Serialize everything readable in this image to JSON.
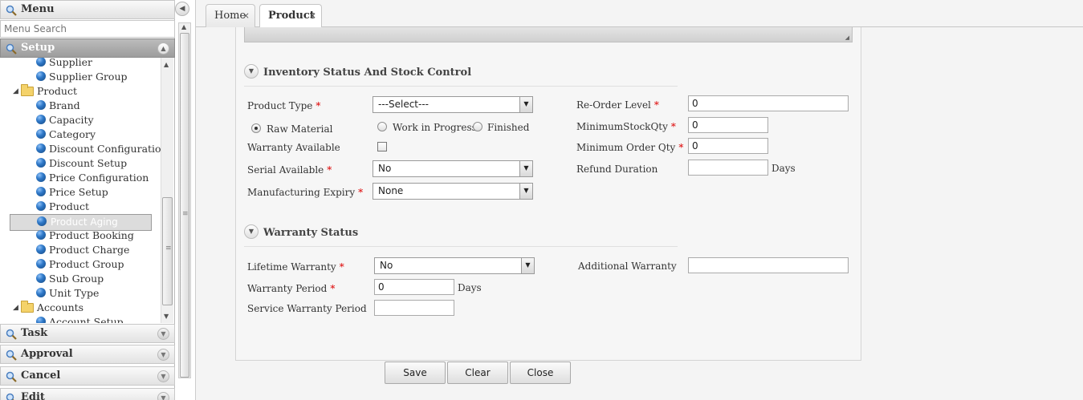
{
  "sidebar": {
    "header": "Menu",
    "search_placeholder": "Menu Search",
    "sections": {
      "setup": "Setup",
      "task": "Task",
      "approval": "Approval",
      "cancel": "Cancel",
      "edit": "Edit"
    },
    "tree": {
      "supplier": "Supplier",
      "supplier_group": "Supplier Group",
      "product_folder": "Product",
      "items": [
        "Brand",
        "Capacity",
        "Category",
        "Discount Configuration",
        "Discount Setup",
        "Price Configuration",
        "Price Setup",
        "Product",
        "Product Aging",
        "Product Booking",
        "Product Charge",
        "Product Group",
        "Sub Group",
        "Unit Type"
      ],
      "selected": "Product Aging",
      "accounts_folder": "Accounts",
      "account_setup": "Account Setup"
    }
  },
  "tabs": [
    {
      "label": "Home"
    },
    {
      "label": "Product"
    }
  ],
  "inventory": {
    "title": "Inventory Status And Stock Control",
    "product_type_label": "Product Type",
    "product_type_value": "---Select---",
    "raw_material": "Raw Material",
    "work_in_progress": "Work in Progress",
    "finished": "Finished",
    "warranty_available_label": "Warranty Available",
    "serial_available_label": "Serial Available",
    "serial_available_value": "No",
    "manufacturing_expiry_label": "Manufacturing Expiry",
    "manufacturing_expiry_value": "None",
    "reorder_level_label": "Re-Order Level",
    "reorder_level_value": "0",
    "min_stock_label": "MinimumStockQty",
    "min_stock_value": "0",
    "min_order_label": "Minimum Order Qty",
    "min_order_value": "0",
    "refund_duration_label": "Refund Duration",
    "refund_duration_value": "",
    "days": "Days"
  },
  "warranty": {
    "title": "Warranty Status",
    "lifetime_label": "Lifetime Warranty",
    "lifetime_value": "No",
    "period_label": "Warranty Period",
    "period_value": "0",
    "days": "Days",
    "service_label": "Service Warranty Period",
    "service_value": "",
    "additional_label": "Additional Warranty",
    "additional_value": ""
  },
  "buttons": {
    "save": "Save",
    "clear": "Clear",
    "close": "Close"
  }
}
